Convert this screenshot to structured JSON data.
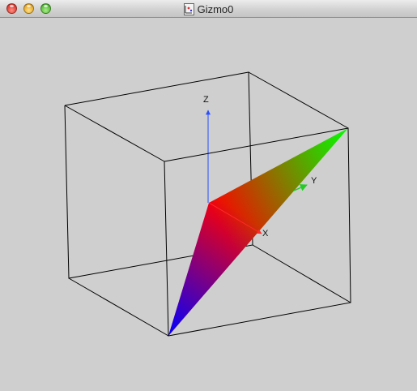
{
  "window": {
    "title": "Gizmo0",
    "icon": "document-proxy-icon"
  },
  "scene": {
    "axes": {
      "x_label": "X",
      "y_label": "Y",
      "z_label": "Z"
    },
    "colors": {
      "background": "#cfcfcf",
      "x_axis": "#ff2a2a",
      "y_axis": "#22cc22",
      "z_axis": "#2a4fff",
      "triangle_red": "#ff0000",
      "triangle_green": "#00ff00",
      "triangle_blue": "#0000ff",
      "bounding_box": "#000000"
    }
  }
}
